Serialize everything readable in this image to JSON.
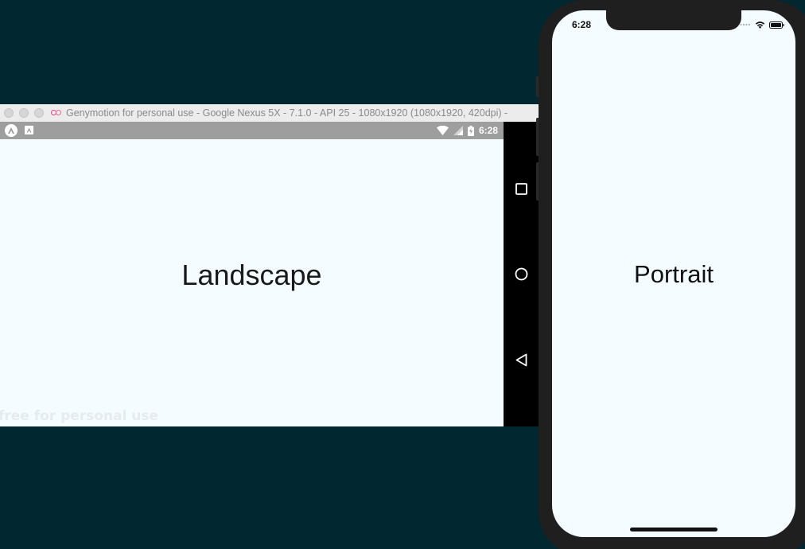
{
  "genymotion": {
    "window_title": "Genymotion for personal use - Google Nexus 5X - 7.1.0 - API 25 - 1080x1920 (1080x1920, 420dpi) -",
    "status_time": "6:28",
    "screen_text": "Landscape",
    "watermark": "free for personal use",
    "nav_icons": [
      "recents-icon",
      "home-icon",
      "back-icon"
    ]
  },
  "ios_simulator": {
    "status_time": "6:28",
    "screen_text": "Portrait",
    "status_icons": [
      "signal-dots-icon",
      "wifi-icon",
      "battery-icon"
    ]
  },
  "colors": {
    "desktop_background": "#012731",
    "app_background": "#f5fcff",
    "android_statusbar": "#9e9e9e",
    "android_navbar": "#000000",
    "device_bezel": "#1f1f1f"
  }
}
